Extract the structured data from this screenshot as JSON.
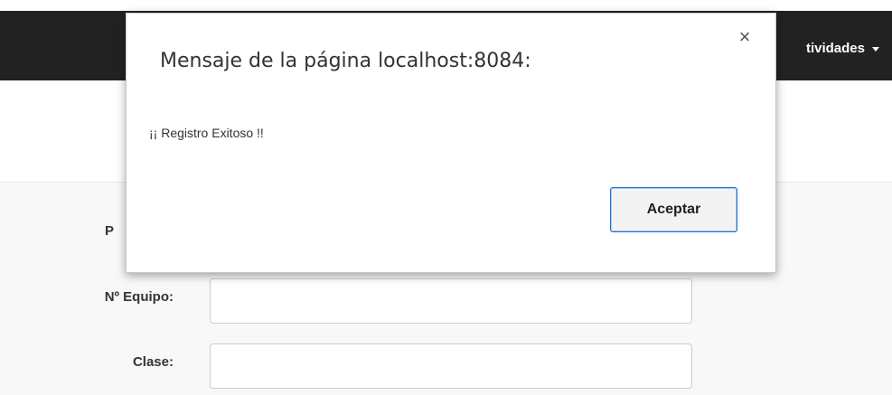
{
  "navbar": {
    "menu_label": "tividades"
  },
  "form": {
    "partial_label": "P",
    "fields": [
      {
        "label": "Nº Equipo:",
        "value": ""
      },
      {
        "label": "Clase:",
        "value": ""
      }
    ]
  },
  "dialog": {
    "title": "Mensaje de la página localhost:8084:",
    "close_symbol": "×",
    "message": "¡¡ Registro Exitoso !!",
    "ok_label": "Aceptar"
  }
}
